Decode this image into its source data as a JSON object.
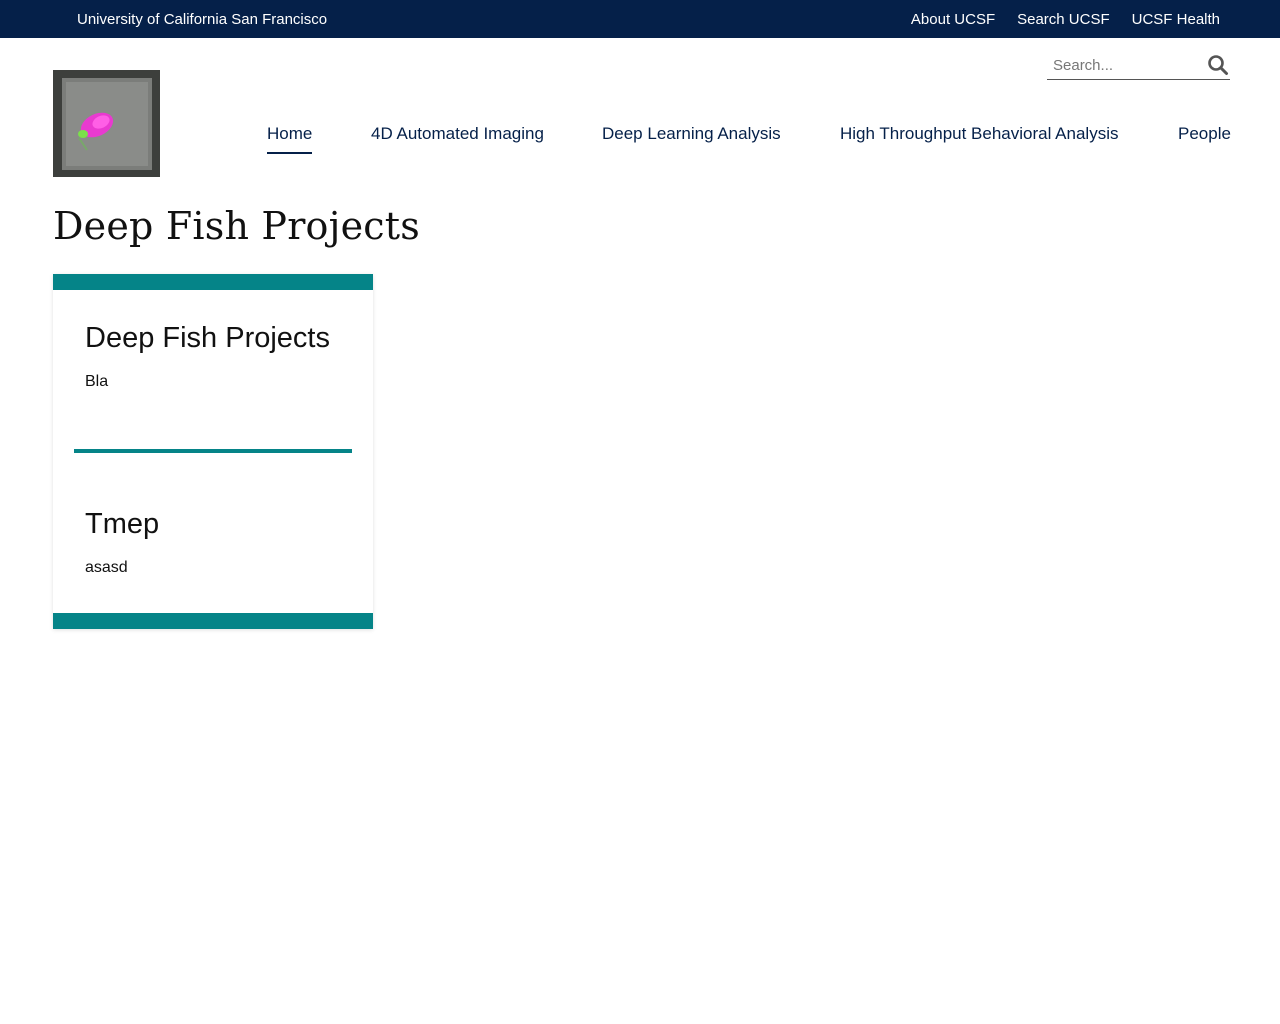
{
  "utility": {
    "brand": "University of California San Francisco",
    "links": [
      "About UCSF",
      "Search UCSF",
      "UCSF Health"
    ]
  },
  "logo": {
    "icon": "zebrafish-larva-logo"
  },
  "search": {
    "placeholder": "Search...",
    "icon": "search-icon"
  },
  "nav": {
    "items": [
      "Home",
      "4D Automated Imaging",
      "Deep Learning Analysis",
      "High Throughput Behavioral Analysis",
      "People"
    ],
    "active": "Home"
  },
  "page": {
    "title": "Deep Fish Projects"
  },
  "card": {
    "sections": [
      {
        "title": "Deep Fish Projects",
        "body": "Bla"
      },
      {
        "title": "Tmep",
        "body": "asasd"
      }
    ]
  },
  "colors": {
    "navy": "#052049",
    "teal": "#058488"
  }
}
